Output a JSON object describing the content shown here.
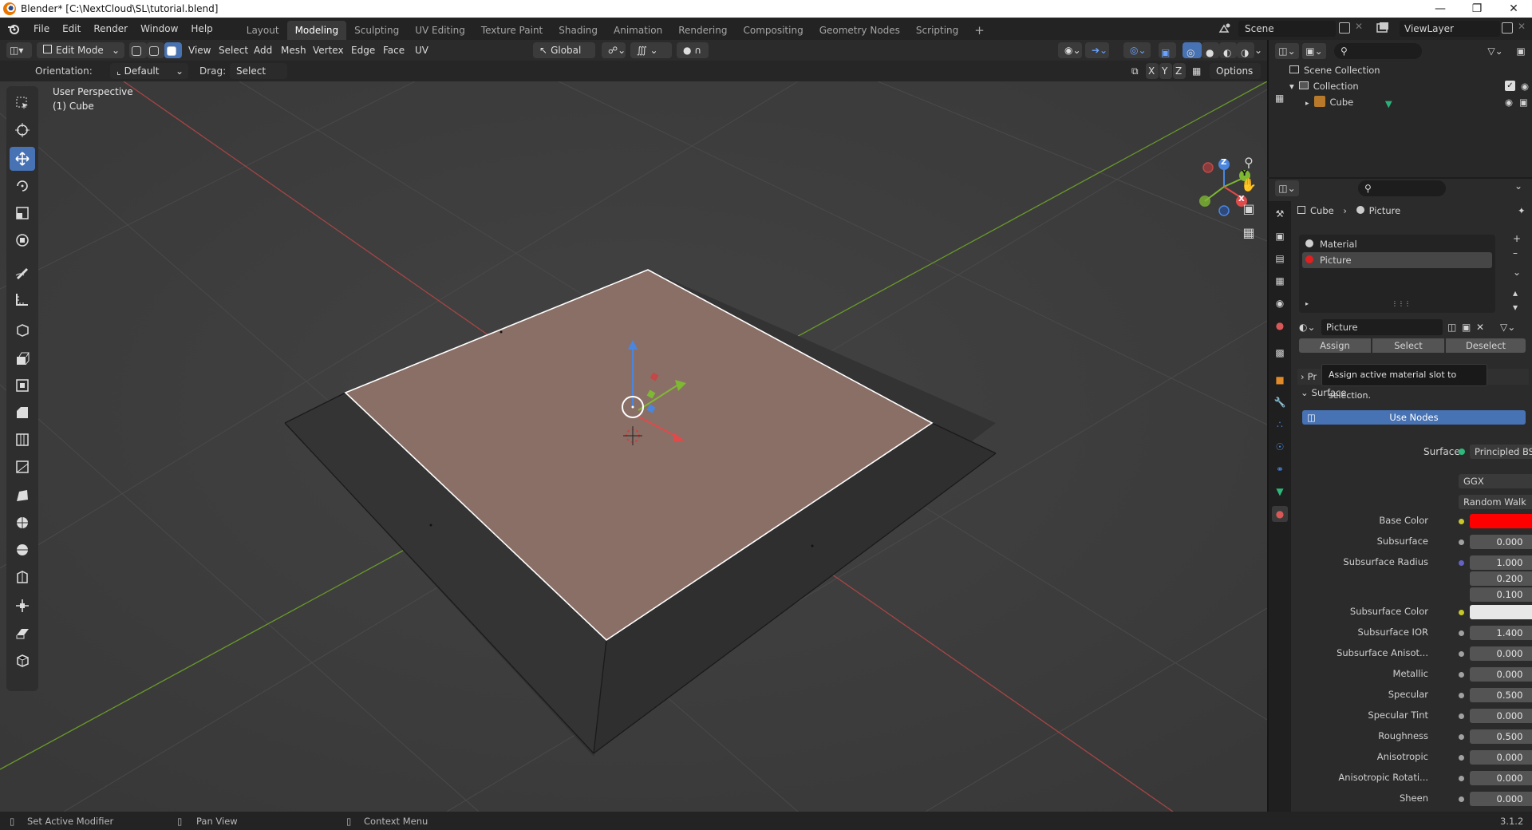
{
  "title_bar": {
    "title": "Blender* [C:\\NextCloud\\SL\\tutorial.blend]"
  },
  "menu": {
    "items": [
      "File",
      "Edit",
      "Render",
      "Window",
      "Help"
    ]
  },
  "workspaces": {
    "tabs": [
      "Layout",
      "Modeling",
      "Sculpting",
      "UV Editing",
      "Texture Paint",
      "Shading",
      "Animation",
      "Rendering",
      "Compositing",
      "Geometry Nodes",
      "Scripting"
    ],
    "active": "Modeling",
    "add": "+"
  },
  "scene": {
    "name": "Scene",
    "view_layer": "ViewLayer"
  },
  "viewport_header": {
    "mode": "Edit Mode",
    "view": "View",
    "select": "Select",
    "add": "Add",
    "mesh": "Mesh",
    "vertex": "Vertex",
    "edge": "Edge",
    "face": "Face",
    "uv": "UV",
    "transform": "Global",
    "orientation_label": "Orientation:",
    "orientation": "Default",
    "drag_label": "Drag:",
    "drag": "Select Box",
    "options": "Options",
    "axes": [
      "X",
      "Y",
      "Z"
    ]
  },
  "viewport": {
    "perspective": "User Perspective",
    "object": "(1) Cube",
    "gizmo_axes": [
      "X",
      "Y",
      "Z"
    ]
  },
  "outliner": {
    "root": "Scene Collection",
    "collection": "Collection",
    "object": "Cube"
  },
  "properties": {
    "breadcrumb": [
      "Cube",
      "Picture"
    ],
    "material_slots": [
      "Material",
      "Picture"
    ],
    "active_slot": "Picture",
    "material_name": "Picture",
    "buttons": {
      "assign": "Assign",
      "select": "Select",
      "deselect": "Deselect"
    },
    "tooltip": "Assign active material slot to selection.",
    "collapsed_panel": "Pr",
    "surface_panel": "Surface",
    "use_nodes": "Use Nodes",
    "surface_label": "Surface",
    "surface_shader": "Principled BSDF",
    "distribution": "GGX",
    "subsurface_method": "Random Walk",
    "inputs": [
      {
        "label": "Base Color",
        "type": "color",
        "color": "#ff0000",
        "socket": "#c7c729"
      },
      {
        "label": "Subsurface",
        "value": "0.000",
        "fill": 0,
        "socket": "#a1a1a1"
      },
      {
        "label": "Subsurface Radius",
        "values": [
          "1.000",
          "0.200",
          "0.100"
        ],
        "socket": "#6363c7"
      },
      {
        "label": "Subsurface Color",
        "type": "color",
        "color": "#e8e8e8",
        "socket": "#c7c729"
      },
      {
        "label": "Subsurface IOR",
        "value": "1.400",
        "fill": 0.14,
        "socket": "#a1a1a1"
      },
      {
        "label": "Subsurface Anisot...",
        "value": "0.000",
        "fill": 0,
        "socket": "#a1a1a1"
      },
      {
        "label": "Metallic",
        "value": "0.000",
        "fill": 0,
        "socket": "#a1a1a1"
      },
      {
        "label": "Specular",
        "value": "0.500",
        "fill": 0.5,
        "socket": "#a1a1a1"
      },
      {
        "label": "Specular Tint",
        "value": "0.000",
        "fill": 0,
        "socket": "#a1a1a1"
      },
      {
        "label": "Roughness",
        "value": "0.500",
        "fill": 0.5,
        "socket": "#a1a1a1"
      },
      {
        "label": "Anisotropic",
        "value": "0.000",
        "fill": 0,
        "socket": "#a1a1a1"
      },
      {
        "label": "Anisotropic Rotati...",
        "value": "0.000",
        "fill": 0,
        "socket": "#a1a1a1"
      },
      {
        "label": "Sheen",
        "value": "0.000",
        "fill": 0,
        "socket": "#a1a1a1"
      }
    ]
  },
  "status_bar": {
    "left": "Set Active Modifier",
    "middle": "Pan View",
    "right": "Context Menu",
    "version": "3.1.2"
  },
  "colors": {
    "accent": "#4772b3",
    "face_select": "#8a6f66",
    "axis_x": "#e04a4a",
    "axis_y": "#7fb833",
    "axis_z": "#4a86e0"
  }
}
